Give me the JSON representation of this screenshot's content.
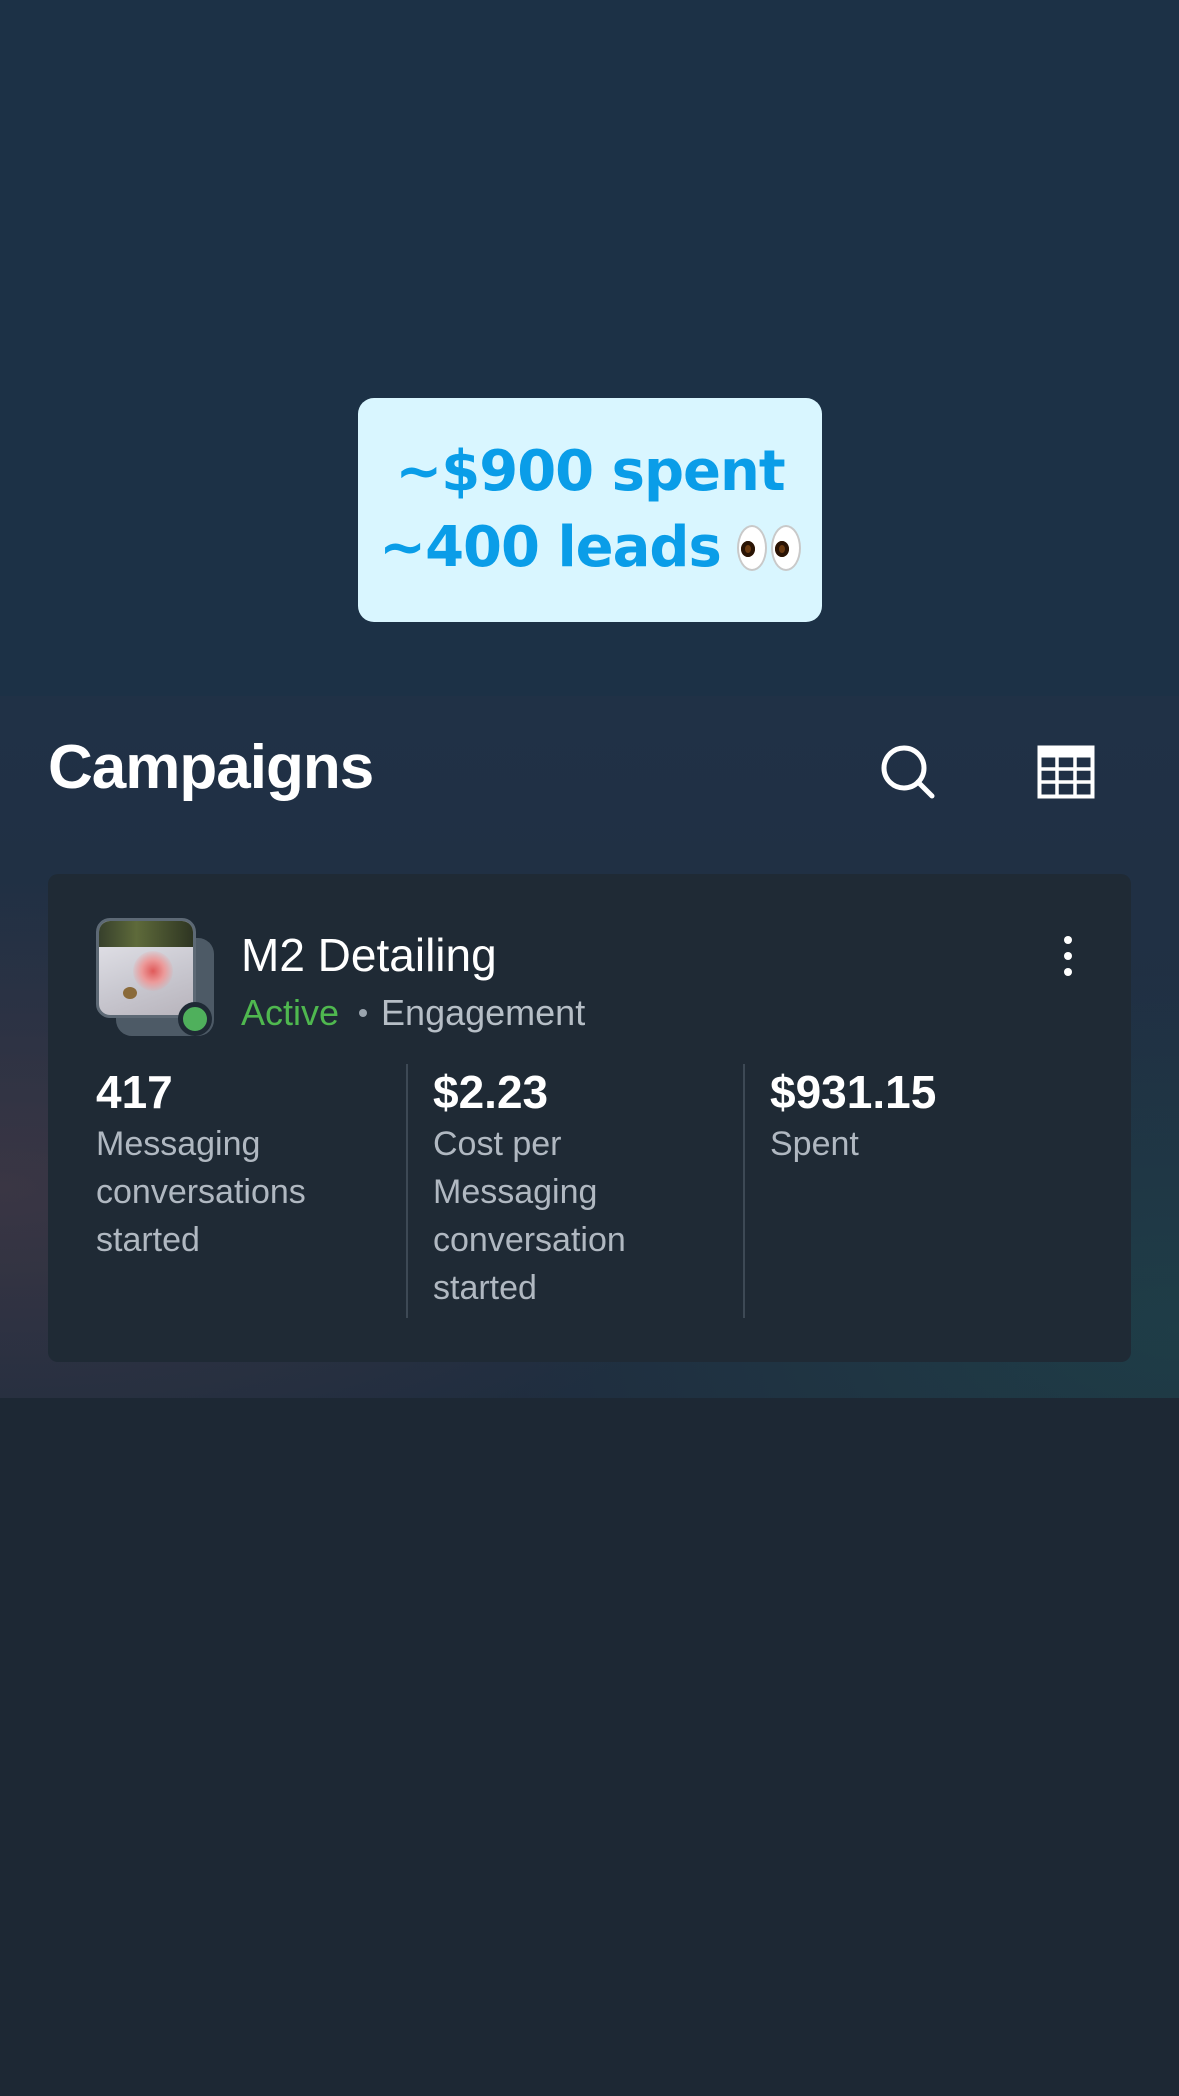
{
  "overlay": {
    "line1": "~$900 spent",
    "line2": "~400 leads",
    "emoji": "eyes-emoji"
  },
  "header": {
    "title": "Campaigns",
    "search_icon": "search-icon",
    "table_icon": "table-grid-icon"
  },
  "campaign": {
    "name": "M2 Detailing",
    "status": "Active",
    "status_color": "#4fb84f",
    "objective": "Engagement",
    "menu_icon": "more-vertical-icon",
    "metrics": [
      {
        "value": "417",
        "label": "Messaging conversations started"
      },
      {
        "value": "$2.23",
        "label": "Cost per Messaging conversation started"
      },
      {
        "value": "$931.15",
        "label": "Spent"
      }
    ]
  },
  "colors": {
    "background": "#1d2834",
    "sticker_bg": "#d9f6ff",
    "sticker_text": "#0a9de8",
    "card_bg": "#1f2a35"
  }
}
